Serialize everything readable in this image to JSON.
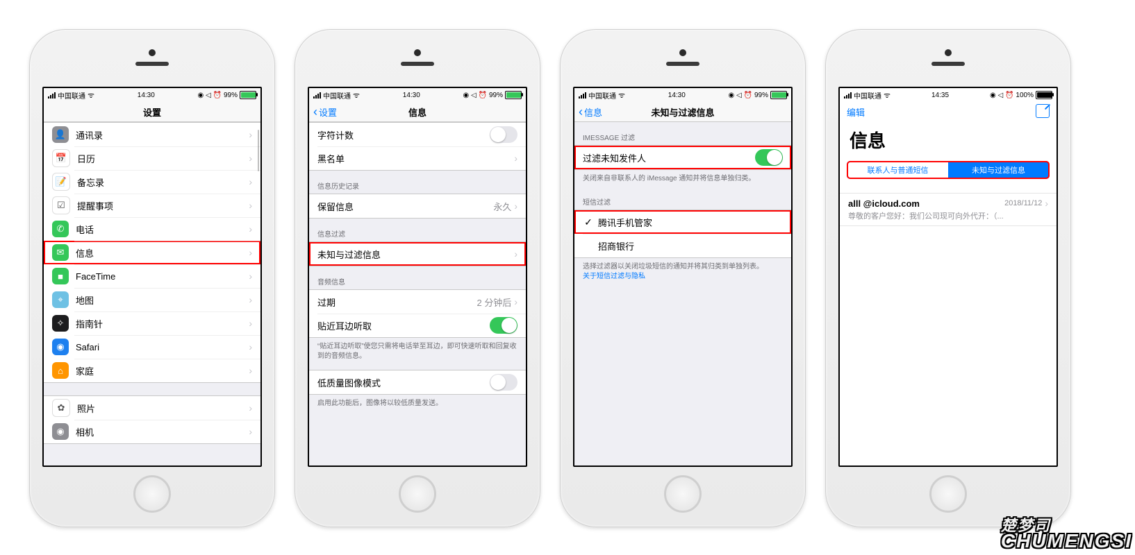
{
  "status": {
    "carrier": "中国联通",
    "time1": "14:30",
    "time4": "14:35",
    "batt1": "99%",
    "batt4": "100%"
  },
  "p1": {
    "title": "设置",
    "items": [
      {
        "label": "通讯录",
        "icon": "#8e8e93",
        "glyph": "👤"
      },
      {
        "label": "日历",
        "icon": "#ffffff",
        "glyph": "📅"
      },
      {
        "label": "备忘录",
        "icon": "#ffffff",
        "glyph": "📝"
      },
      {
        "label": "提醒事项",
        "icon": "#ffffff",
        "glyph": "☑︎"
      },
      {
        "label": "电话",
        "icon": "#34c759",
        "glyph": "✆"
      },
      {
        "label": "信息",
        "icon": "#34c759",
        "glyph": "✉︎",
        "hl": true
      },
      {
        "label": "FaceTime",
        "icon": "#34c759",
        "glyph": "■"
      },
      {
        "label": "地图",
        "icon": "#6ec1e4",
        "glyph": "⌖"
      },
      {
        "label": "指南针",
        "icon": "#1c1c1e",
        "glyph": "✧"
      },
      {
        "label": "Safari",
        "icon": "#1e80ef",
        "glyph": "◉"
      },
      {
        "label": "家庭",
        "icon": "#ff9500",
        "glyph": "⌂"
      },
      {
        "label": "照片",
        "icon": "#ffffff",
        "glyph": "✿"
      },
      {
        "label": "相机",
        "icon": "#8e8e93",
        "glyph": "◉"
      }
    ]
  },
  "p2": {
    "back": "设置",
    "title": "信息",
    "g1": [
      {
        "label": "字符计数",
        "switch": false
      },
      {
        "label": "黑名单",
        "chev": true
      }
    ],
    "h2": "信息历史记录",
    "g2": [
      {
        "label": "保留信息",
        "value": "永久",
        "chev": true
      }
    ],
    "h3": "信息过滤",
    "g3": [
      {
        "label": "未知与过滤信息",
        "chev": true,
        "hl": true
      }
    ],
    "h4": "音频信息",
    "g4": [
      {
        "label": "过期",
        "value": "2 分钟后",
        "chev": true
      },
      {
        "label": "贴近耳边听取",
        "switch": true
      }
    ],
    "f4": "“贴近耳边听取”使您只需将电话举至耳边，即可快速听取和回复收到的音频信息。",
    "g5": [
      {
        "label": "低质量图像模式",
        "switch": false
      }
    ],
    "f5": "启用此功能后，图像将以较低质量发送。"
  },
  "p3": {
    "back": "信息",
    "title": "未知与过滤信息",
    "h1": "IMESSAGE 过滤",
    "g1": [
      {
        "label": "过滤未知发件人",
        "switch": true,
        "hl": true
      }
    ],
    "f1": "关闭来自非联系人的 iMessage 通知并将信息单独归类。",
    "h2": "短信过滤",
    "g2": [
      {
        "label": "腾讯手机管家",
        "check": true,
        "hl": true
      },
      {
        "label": "招商银行"
      }
    ],
    "f2": "选择过滤器以关闭垃圾短信的通知并将其归类到单独列表。",
    "f2link": "关于短信过滤与隐私"
  },
  "p4": {
    "edit": "编辑",
    "bigtitle": "信息",
    "seg": [
      "联系人与普通短信",
      "未知与过滤信息"
    ],
    "msg": {
      "from": "all​l       @icloud.com",
      "date": "2018/11/12",
      "preview": "尊敬的客户您好：我们公司现可向外代开：（..."
    }
  },
  "watermark": {
    "cn": "楚梦司",
    "en": "CHUMENGSI"
  }
}
